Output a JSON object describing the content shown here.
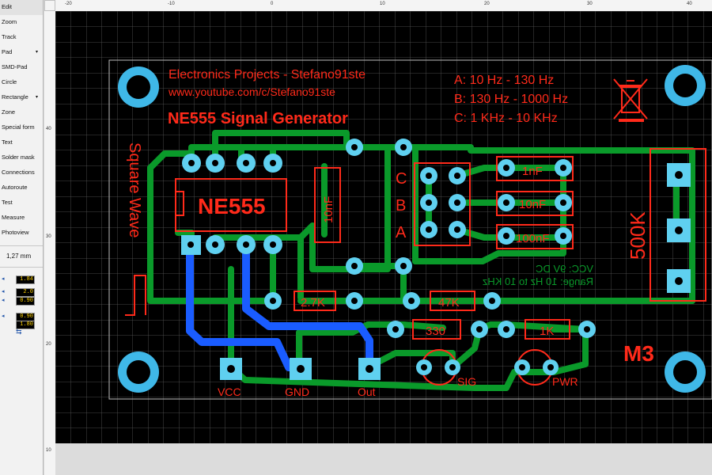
{
  "toolbar": {
    "items": [
      {
        "label": "Edit"
      },
      {
        "label": "Zoom"
      },
      {
        "label": "Track"
      },
      {
        "label": "Pad",
        "has_menu": true
      },
      {
        "label": "SMD-Pad"
      },
      {
        "label": "Circle"
      },
      {
        "label": "Rectangle",
        "has_menu": true
      },
      {
        "label": "Zone"
      },
      {
        "label": "Special form"
      },
      {
        "label": "Text"
      },
      {
        "label": "Solder mask"
      },
      {
        "label": "Connections"
      },
      {
        "label": "Autoroute"
      },
      {
        "label": "Test"
      },
      {
        "label": "Measure"
      },
      {
        "label": "Photoview"
      }
    ],
    "grid_size": "1,27 mm",
    "track_values": [
      "1.84",
      "2.0",
      "0.90",
      "1.80",
      "0.90"
    ]
  },
  "ruler": {
    "top": [
      "-20",
      "-10",
      "0",
      "10",
      "20",
      "30",
      "40"
    ],
    "left": [
      "40",
      "30",
      "20",
      "10"
    ]
  },
  "pcb": {
    "header_line1": "Electronics Projects - Stefano91ste",
    "header_line2": "www.youtube.com/c/Stefano91ste",
    "title": "NE555 Signal Generator",
    "ranges": [
      "A: 10 Hz - 130 Hz",
      "B: 130 Hz - 1000 Hz",
      "C: 1 KHz - 10 KHz"
    ],
    "ic_label": "NE555",
    "square_wave": "Square Wave",
    "cap_10n_vertical": "10nF",
    "switch_letters": [
      "C",
      "B",
      "A"
    ],
    "caps": [
      "1nF",
      "10nF",
      "100nF"
    ],
    "pot": "500K",
    "resistors": [
      "2.7K",
      "47K",
      "330",
      "1K"
    ],
    "mirrored_notes": [
      "VCC: 9V DC",
      "Range: 10 Hz to 10 KHz"
    ],
    "model": "M3",
    "pad_labels": [
      "VCC",
      "GND",
      "Out"
    ],
    "led_labels": [
      "SIG",
      "PWR"
    ]
  },
  "colors": {
    "board_bg": "#000000",
    "grid": "#5a5a5a",
    "copper_top": "#0a9a2a",
    "copper_bottom": "#1a5cff",
    "silk": "#ff2a1a",
    "pad": "#5fd0f0",
    "mounting_hole": "#3fb8e8"
  }
}
